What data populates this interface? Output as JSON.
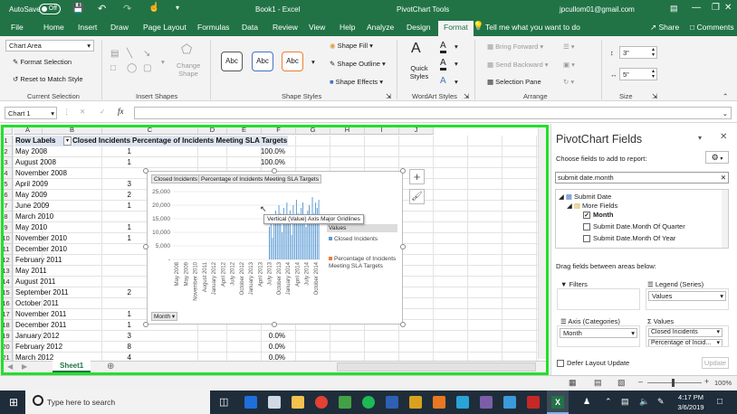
{
  "titlebar": {
    "autosave_label": "AutoSave",
    "autosave_state": "Off",
    "doc_title": "Book1 - Excel",
    "context_title": "PivotChart Tools",
    "user_email": "jpcullom01@gmail.com"
  },
  "tabs": [
    "File",
    "Home",
    "Insert",
    "Draw",
    "Page Layout",
    "Formulas",
    "Data",
    "Review",
    "View",
    "Help",
    "Analyze",
    "Design",
    "Format"
  ],
  "tell_me": "Tell me what you want to do",
  "share_label": "Share",
  "comments_label": "Comments",
  "ribbon": {
    "current_selection": {
      "dropdown_value": "Chart Area",
      "format_selection": "Format Selection",
      "reset_match": "Reset to Match Style",
      "group_label": "Current Selection"
    },
    "insert_shapes": {
      "change_shape": "Change Shape",
      "group_label": "Insert Shapes"
    },
    "shape_styles": {
      "style_sample": "Abc",
      "shape_fill": "Shape Fill",
      "shape_outline": "Shape Outline",
      "shape_effects": "Shape Effects",
      "group_label": "Shape Styles"
    },
    "wordart": {
      "quick_styles": "Quick Styles",
      "group_label": "WordArt Styles"
    },
    "arrange": {
      "bring_forward": "Bring Forward",
      "send_backward": "Send Backward",
      "selection_pane": "Selection Pane",
      "group_label": "Arrange"
    },
    "size": {
      "height": "3\"",
      "width": "5\"",
      "group_label": "Size"
    }
  },
  "formula_bar": {
    "name_box": "Chart 1",
    "fx": "fx",
    "value": ""
  },
  "columns": [
    "A",
    "B",
    "C",
    "D",
    "E",
    "F",
    "G",
    "H",
    "I",
    "J"
  ],
  "pivot_header": {
    "row_labels": "Row Labels",
    "closed": "Closed Incidents",
    "pct": "Percentage of Incidents Meeting SLA Targets"
  },
  "rows": [
    {
      "num": "1"
    },
    {
      "num": "2",
      "a": "May 2008",
      "b": "1",
      "c": "100.0%"
    },
    {
      "num": "3",
      "a": "August 2008",
      "b": "1",
      "c": "100.0%"
    },
    {
      "num": "4",
      "a": "November 2008",
      "b": "",
      "c": ""
    },
    {
      "num": "5",
      "a": "April 2009",
      "b": "3",
      "c": ""
    },
    {
      "num": "6",
      "a": "May 2009",
      "b": "2",
      "c": ""
    },
    {
      "num": "7",
      "a": "June 2009",
      "b": "1",
      "c": ""
    },
    {
      "num": "8",
      "a": "March 2010",
      "b": "",
      "c": ""
    },
    {
      "num": "9",
      "a": "May 2010",
      "b": "1",
      "c": ""
    },
    {
      "num": "10",
      "a": "November 2010",
      "b": "1",
      "c": ""
    },
    {
      "num": "11",
      "a": "December 2010",
      "b": "",
      "c": ""
    },
    {
      "num": "12",
      "a": "February 2011",
      "b": "",
      "c": ""
    },
    {
      "num": "13",
      "a": "May 2011",
      "b": "",
      "c": ""
    },
    {
      "num": "14",
      "a": "August 2011",
      "b": "",
      "c": ""
    },
    {
      "num": "15",
      "a": "September 2011",
      "b": "2",
      "c": ""
    },
    {
      "num": "16",
      "a": "October 2011",
      "b": "",
      "c": ""
    },
    {
      "num": "17",
      "a": "November 2011",
      "b": "1",
      "c": ""
    },
    {
      "num": "18",
      "a": "December 2011",
      "b": "1",
      "c": ""
    },
    {
      "num": "19",
      "a": "January 2012",
      "b": "3",
      "c": "0.0%"
    },
    {
      "num": "20",
      "a": "February 2012",
      "b": "8",
      "c": "0.0%"
    },
    {
      "num": "21",
      "a": "March 2012",
      "b": "4",
      "c": "0.0%"
    }
  ],
  "chart": {
    "field_button_1": "Closed Incidents",
    "field_button_2": "Percentage of Incidents Meeting SLA Targets",
    "tooltip": "Vertical (Value) Axis Major Gridlines",
    "legend_title": "Values",
    "axis_field_button": "Month"
  },
  "chart_data": {
    "type": "bar",
    "y_ticks": [
      "25,000",
      "20,000",
      "15,000",
      "10,000",
      "5,000",
      "-"
    ],
    "ylim": [
      0,
      25000
    ],
    "x_ticks": [
      "May 2008",
      "May 2009",
      "November 2010",
      "August 2011",
      "January 2012",
      "April 2012",
      "July 2012",
      "October 2012",
      "January 2013",
      "April 2013",
      "July 2013",
      "October 2013",
      "January 2014",
      "April 2014",
      "July 2014",
      "October 2014"
    ],
    "series": [
      {
        "name": "Closed Incidents",
        "color": "#5b9bd5",
        "values": [
          0,
          0,
          0,
          0,
          0,
          0,
          0,
          0,
          0,
          0,
          0,
          0,
          0,
          0,
          0,
          0,
          0,
          0,
          0,
          0,
          0,
          0,
          0,
          0,
          0,
          0,
          0,
          0,
          0,
          0,
          0,
          0,
          0,
          0,
          0,
          0,
          0,
          0,
          0,
          0,
          0,
          0,
          0,
          0,
          0,
          0,
          0,
          0,
          0,
          0,
          0,
          0,
          0,
          0,
          0,
          0,
          0,
          0,
          0,
          0,
          12000,
          15000,
          8000,
          16000,
          18000,
          14000,
          20000,
          17000,
          10000,
          19000,
          16000,
          21000,
          13000,
          18000,
          9000,
          20000,
          15000,
          22000,
          17000,
          14000,
          19000,
          21000,
          16000,
          12000,
          18000,
          20000,
          15000,
          23000,
          17000,
          21000,
          19000,
          22000
        ]
      },
      {
        "name": "Percentage of Incidents Meeting SLA Targets",
        "color": "#ed7d31",
        "values": []
      }
    ]
  },
  "sheet_tab": "Sheet1",
  "pivot_panel": {
    "title": "PivotChart Fields",
    "choose_label": "Choose fields to add to report:",
    "search_value": "submit date.month",
    "tree": {
      "root": "Submit Date",
      "group": "More Fields",
      "items": [
        {
          "label": "Month",
          "checked": true
        },
        {
          "label": "Submit Date.Month Of Quarter",
          "checked": false
        },
        {
          "label": "Submit Date.Month Of Year",
          "checked": false
        }
      ]
    },
    "drag_label": "Drag fields between areas below:",
    "filters_label": "Filters",
    "legend_label": "Legend (Series)",
    "legend_value": "Values",
    "axis_label": "Axis (Categories)",
    "axis_value": "Month",
    "values_label": "Values",
    "values_items": [
      "Closed Incidents",
      "Percentage of Incid..."
    ],
    "defer_label": "Defer Layout Update",
    "update_label": "Update"
  },
  "status": {
    "zoom": "100%"
  },
  "taskbar": {
    "search_placeholder": "Type here to search",
    "time": "4:17 PM",
    "date": "3/6/2019"
  }
}
